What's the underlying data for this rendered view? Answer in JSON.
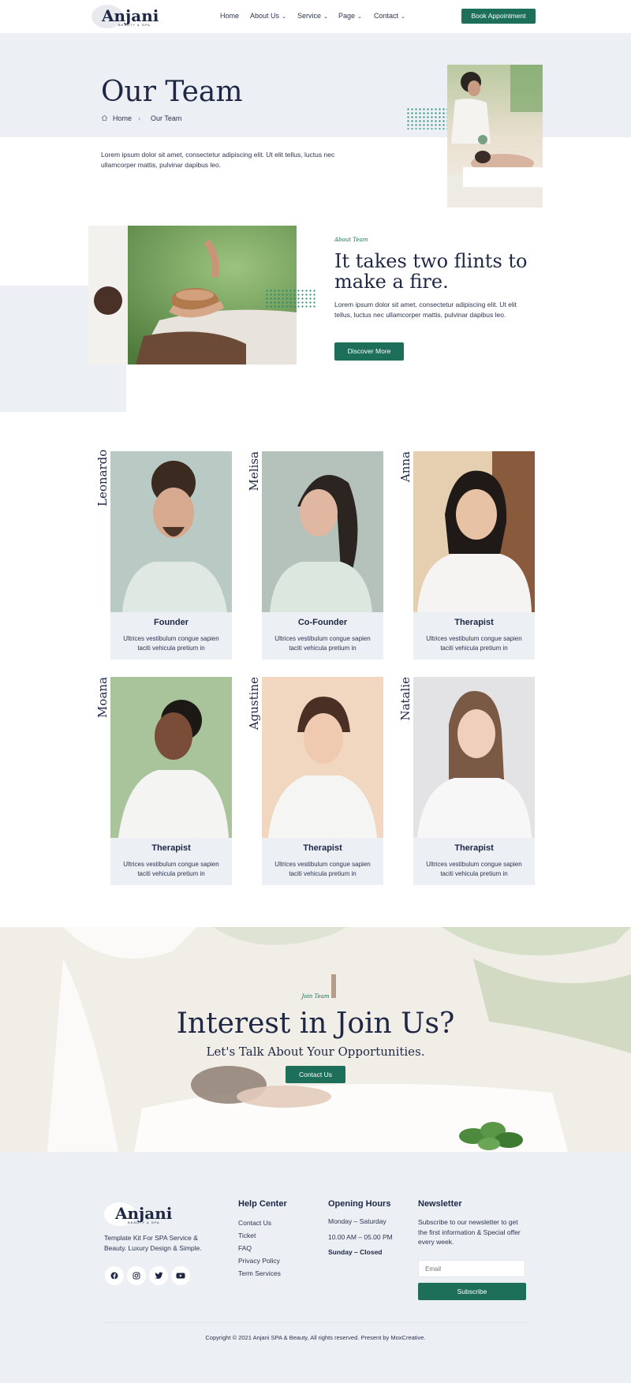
{
  "header": {
    "logo": "Anjani",
    "logo_sub": "BEAUTY & SPA",
    "nav": [
      {
        "label": "Home"
      },
      {
        "label": "About Us"
      },
      {
        "label": "Service"
      },
      {
        "label": "Page"
      },
      {
        "label": "Contact"
      }
    ],
    "cta_label": "Book Appointment"
  },
  "hero": {
    "title": "Our Team",
    "breadcrumb": [
      "Home",
      "Our Team"
    ],
    "description": "Lorem ipsum dolor sit amet, consectetur adipiscing elit. Ut elit tellus, luctus nec ullamcorper mattis, pulvinar dapibus leo."
  },
  "about": {
    "eyebrow": "About Team",
    "title": "It takes two flints to make a fire.",
    "description": "Lorem ipsum dolor sit amet, consectetur adipiscing elit. Ut elit tellus, luctus nec ullamcorper mattis, pulvinar dapibus leo.",
    "button_label": "Discover More"
  },
  "team": [
    {
      "name": "Leonardo",
      "role": "Founder",
      "text": "Ultrices vestibulum congue sapien taciti vehicula pretium in"
    },
    {
      "name": "Melisa",
      "role": "Co-Founder",
      "text": "Ultrices vestibulum congue sapien taciti vehicula pretium in"
    },
    {
      "name": "Anna",
      "role": "Therapist",
      "text": "Ultrices vestibulum congue sapien taciti vehicula pretium in"
    },
    {
      "name": "Moana",
      "role": "Therapist",
      "text": "Ultrices vestibulum congue sapien taciti vehicula pretium in"
    },
    {
      "name": "Agustine",
      "role": "Therapist",
      "text": "Ultrices vestibulum congue sapien taciti vehicula pretium in"
    },
    {
      "name": "Natalie",
      "role": "Therapist",
      "text": "Ultrices vestibulum congue sapien taciti vehicula pretium in"
    }
  ],
  "cta": {
    "eyebrow": "Join Team",
    "title": "Interest in Join Us?",
    "subtitle": "Let's Talk About Your Opportunities.",
    "button_label": "Contact Us"
  },
  "footer": {
    "logo": "Anjani",
    "logo_sub": "BEAUTY & SPA",
    "tagline": "Template Kit For SPA Service & Beauty. Luxury Design & Simple.",
    "social_icons": [
      "facebook-icon",
      "instagram-icon",
      "twitter-icon",
      "youtube-icon"
    ],
    "help_center": {
      "heading": "Help Center",
      "links": [
        "Contact Us",
        "Ticket",
        "FAQ",
        "Privacy Policy",
        "Term Services"
      ]
    },
    "opening_hours": {
      "heading": "Opening Hours",
      "days": "Monday – Saturday",
      "time": "10.00 AM – 05.00 PM",
      "closed": "Sunday – Closed"
    },
    "newsletter": {
      "heading": "Newsletter",
      "text": "Subscribe to our newsletter to get the first information & Special offer every week.",
      "placeholder": "Email",
      "button_label": "Subscribe"
    },
    "copyright": "Copyright © 2021 Anjani SPA & Beauty, All rights reserved. Present by MoxCreative."
  },
  "colors": {
    "accent": "#1e6f5a",
    "navy": "#1e2744",
    "light_gray": "#eceff3"
  }
}
